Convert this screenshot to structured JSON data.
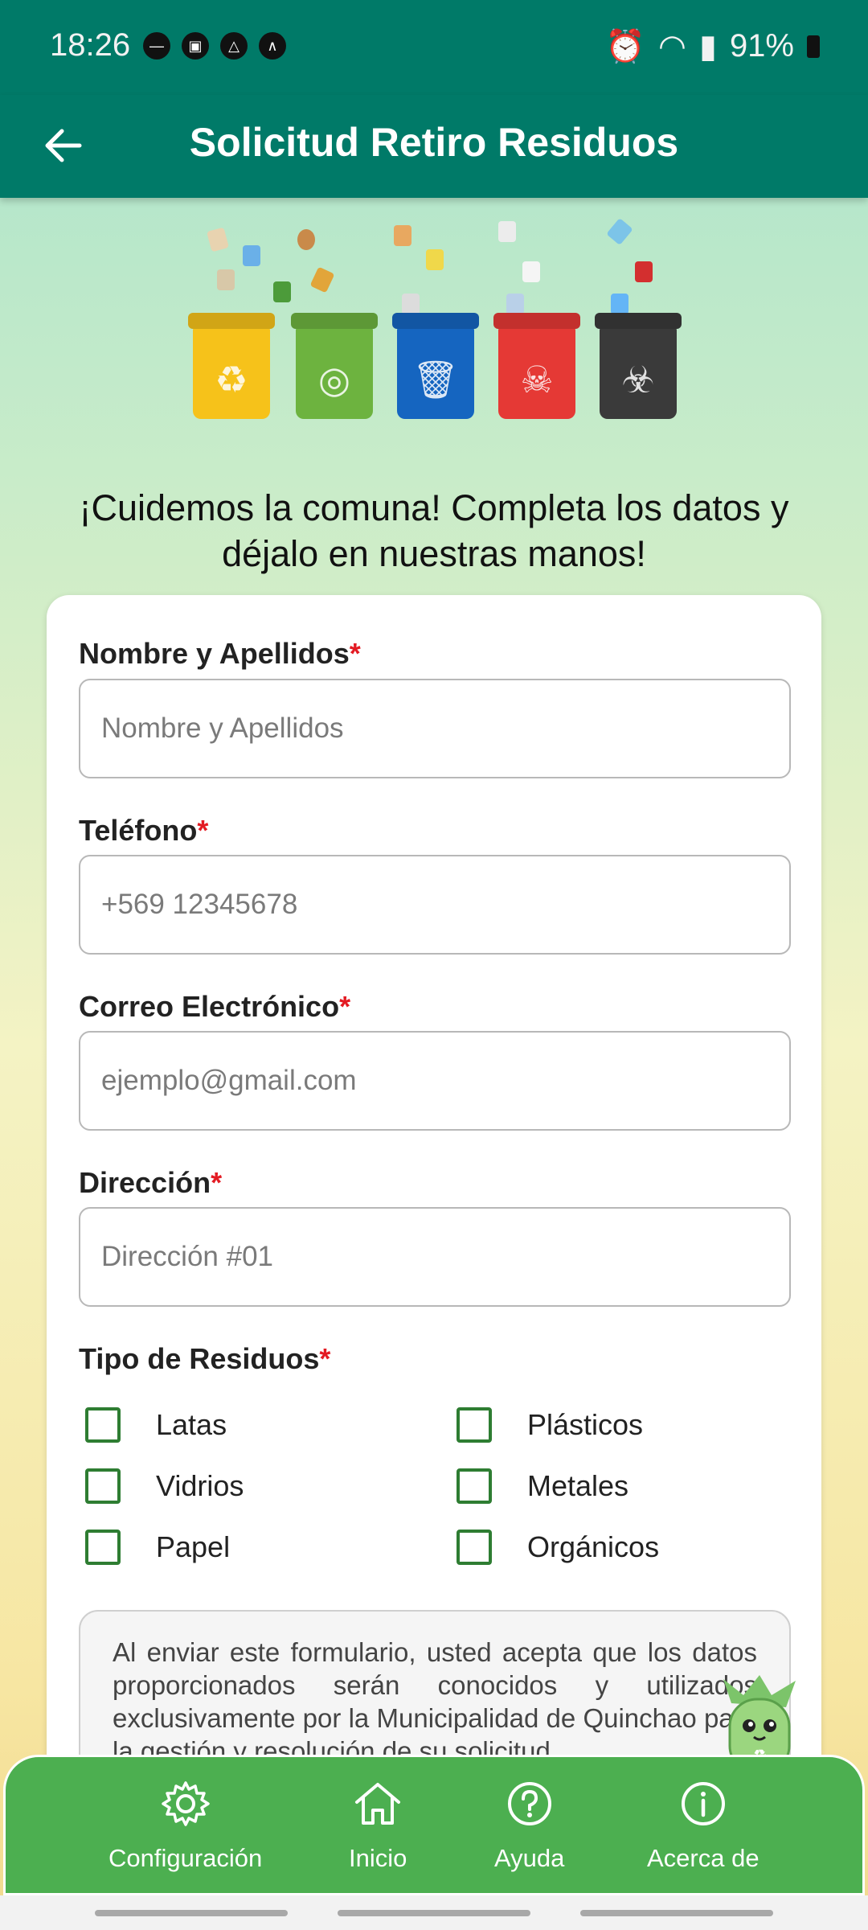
{
  "status_bar": {
    "time": "18:26",
    "battery": "91%"
  },
  "app_bar": {
    "title": "Solicitud Retiro Residuos"
  },
  "headline": "¡Cuidemos la comuna! Completa los datos y déjalo en nuestras manos!",
  "form": {
    "fields": [
      {
        "label": "Nombre y Apellidos",
        "required_mark": "*",
        "placeholder": "Nombre y Apellidos"
      },
      {
        "label": "Teléfono",
        "required_mark": "*",
        "placeholder": "+569 12345678"
      },
      {
        "label": "Correo Electrónico",
        "required_mark": "*",
        "placeholder": "ejemplo@gmail.com"
      },
      {
        "label": "Dirección",
        "required_mark": "*",
        "placeholder": "Dirección #01"
      }
    ],
    "waste_types": {
      "label": "Tipo de Residuos",
      "required_mark": "*",
      "options": [
        "Latas",
        "Plásticos",
        "Vidrios",
        "Metales",
        "Papel",
        "Orgánicos"
      ]
    },
    "consent_text": "Al enviar este formulario, usted acepta que los datos proporcionados serán conocidos y utilizados exclusivamente por la Municipalidad de Quinchao para la gestión y resolución de su solicitud."
  },
  "bottom_nav": [
    {
      "label": "Configuración",
      "icon": "gear-icon"
    },
    {
      "label": "Inicio",
      "icon": "home-icon"
    },
    {
      "label": "Ayuda",
      "icon": "help-icon"
    },
    {
      "label": "Acerca de",
      "icon": "info-icon"
    }
  ],
  "colors": {
    "primary": "#007a68",
    "nav_green": "#4caf50",
    "checkbox_green": "#2e7d32",
    "required_red": "#e31b23",
    "bin_yellow": "#f6c21a",
    "bin_green": "#6db33f",
    "bin_blue": "#1565c0",
    "bin_red": "#e53935",
    "bin_black": "#3a3a3a"
  }
}
